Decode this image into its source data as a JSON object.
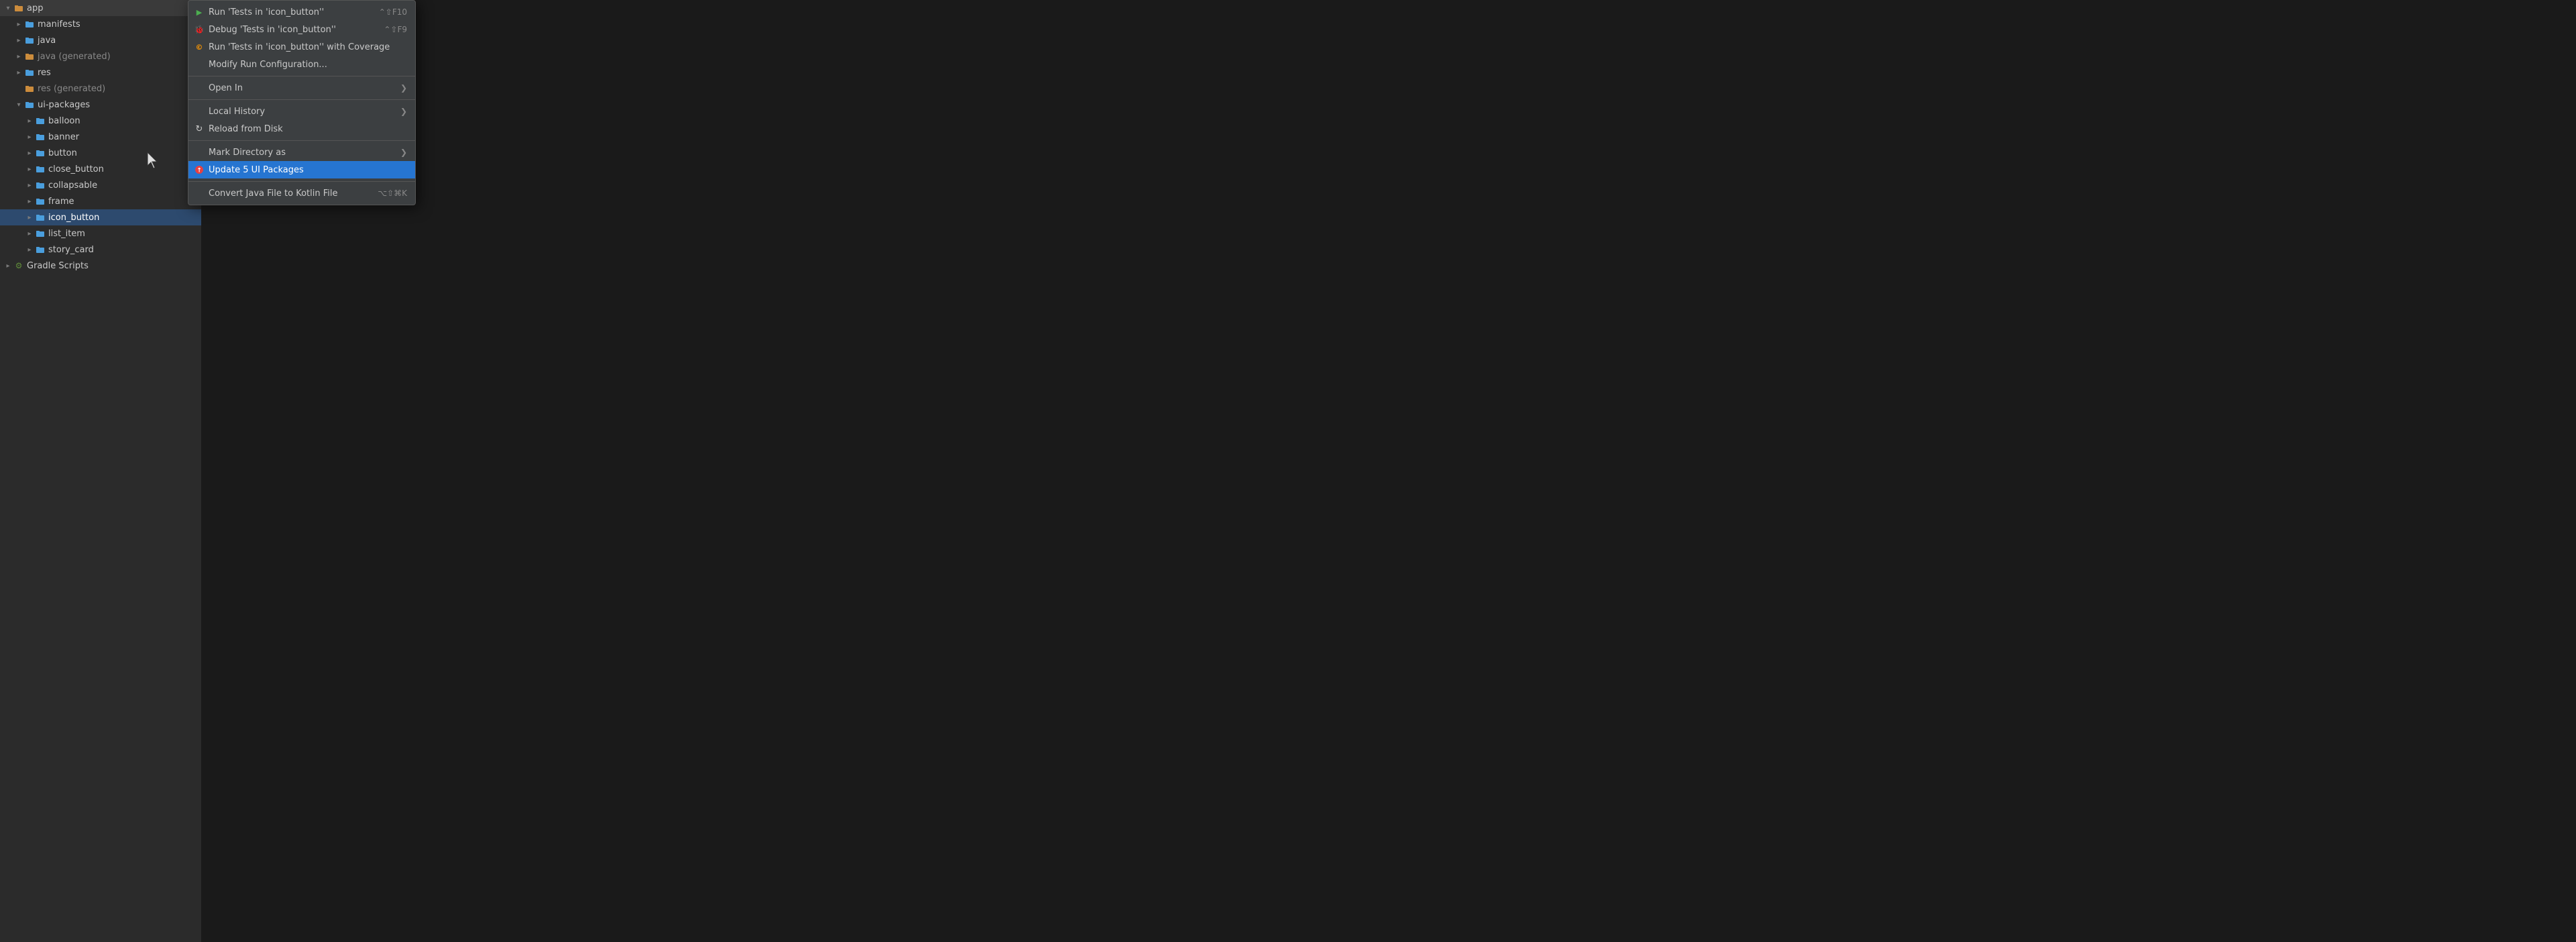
{
  "sidebar": {
    "items": [
      {
        "id": "app",
        "label": "app",
        "level": 0,
        "expanded": true,
        "type": "folder",
        "color": "orange",
        "selected": false
      },
      {
        "id": "manifests",
        "label": "manifests",
        "level": 1,
        "expanded": false,
        "type": "folder",
        "color": "blue",
        "selected": false
      },
      {
        "id": "java",
        "label": "java",
        "level": 1,
        "expanded": false,
        "type": "folder",
        "color": "blue",
        "selected": false
      },
      {
        "id": "java-generated",
        "label": "java (generated)",
        "level": 1,
        "expanded": false,
        "type": "folder",
        "color": "orange",
        "selected": false,
        "muted": true
      },
      {
        "id": "res",
        "label": "res",
        "level": 1,
        "expanded": false,
        "type": "folder",
        "color": "blue",
        "selected": false
      },
      {
        "id": "res-generated",
        "label": "res (generated)",
        "level": 1,
        "expanded": false,
        "type": "folder",
        "color": "orange",
        "selected": false,
        "muted": true,
        "no_chevron": true
      },
      {
        "id": "ui-packages",
        "label": "ui-packages",
        "level": 1,
        "expanded": true,
        "type": "folder",
        "color": "blue",
        "selected": false
      },
      {
        "id": "balloon",
        "label": "balloon",
        "level": 2,
        "expanded": false,
        "type": "folder",
        "color": "blue",
        "selected": false
      },
      {
        "id": "banner",
        "label": "banner",
        "level": 2,
        "expanded": false,
        "type": "folder",
        "color": "blue",
        "selected": false
      },
      {
        "id": "button",
        "label": "button",
        "level": 2,
        "expanded": false,
        "type": "folder",
        "color": "blue",
        "selected": false
      },
      {
        "id": "close_button",
        "label": "close_button",
        "level": 2,
        "expanded": false,
        "type": "folder",
        "color": "blue",
        "selected": false
      },
      {
        "id": "collapsable",
        "label": "collapsable",
        "level": 2,
        "expanded": false,
        "type": "folder",
        "color": "blue",
        "selected": false
      },
      {
        "id": "frame",
        "label": "frame",
        "level": 2,
        "expanded": false,
        "type": "folder",
        "color": "blue",
        "selected": false
      },
      {
        "id": "icon_button",
        "label": "icon_button",
        "level": 2,
        "expanded": false,
        "type": "folder",
        "color": "blue",
        "selected": true
      },
      {
        "id": "list_item",
        "label": "list_item",
        "level": 2,
        "expanded": false,
        "type": "folder",
        "color": "blue",
        "selected": false
      },
      {
        "id": "story_card",
        "label": "story_card",
        "level": 2,
        "expanded": false,
        "type": "folder",
        "color": "blue",
        "selected": false
      },
      {
        "id": "gradle-scripts",
        "label": "Gradle Scripts",
        "level": 0,
        "expanded": false,
        "type": "gradle",
        "selected": false
      }
    ]
  },
  "context_menu": {
    "items": [
      {
        "id": "run-tests",
        "label": "Run 'Tests in 'icon_button''",
        "shortcut": "⌃⇧F10",
        "icon": "run",
        "type": "item"
      },
      {
        "id": "debug-tests",
        "label": "Debug 'Tests in 'icon_button''",
        "shortcut": "⌃⇧F9",
        "icon": "debug",
        "type": "item"
      },
      {
        "id": "run-coverage",
        "label": "Run 'Tests in 'icon_button'' with Coverage",
        "shortcut": "",
        "icon": "coverage",
        "type": "item"
      },
      {
        "id": "modify-run",
        "label": "Modify Run Configuration...",
        "shortcut": "",
        "icon": "",
        "type": "item"
      },
      {
        "id": "sep1",
        "type": "separator"
      },
      {
        "id": "open-in",
        "label": "Open In",
        "shortcut": "",
        "icon": "",
        "type": "submenu"
      },
      {
        "id": "sep2",
        "type": "separator"
      },
      {
        "id": "local-history",
        "label": "Local History",
        "shortcut": "",
        "icon": "",
        "type": "submenu"
      },
      {
        "id": "reload-disk",
        "label": "Reload from Disk",
        "shortcut": "",
        "icon": "reload",
        "type": "item"
      },
      {
        "id": "sep3",
        "type": "separator"
      },
      {
        "id": "mark-directory",
        "label": "Mark Directory as",
        "shortcut": "",
        "icon": "",
        "type": "submenu"
      },
      {
        "id": "update-packages",
        "label": "Update 5 UI Packages",
        "shortcut": "",
        "icon": "update",
        "type": "item",
        "highlighted": true
      },
      {
        "id": "sep4",
        "type": "separator"
      },
      {
        "id": "convert-kotlin",
        "label": "Convert Java File to Kotlin File",
        "shortcut": "⌥⇧⌘K",
        "icon": "",
        "type": "item"
      }
    ]
  },
  "icons": {
    "chevron_right": "▶",
    "chevron_down": "▼",
    "submenu_arrow": "❯",
    "folder": "📁",
    "run": "▶",
    "debug": "🐛",
    "coverage": "©",
    "reload": "↻",
    "update": "🔄"
  }
}
